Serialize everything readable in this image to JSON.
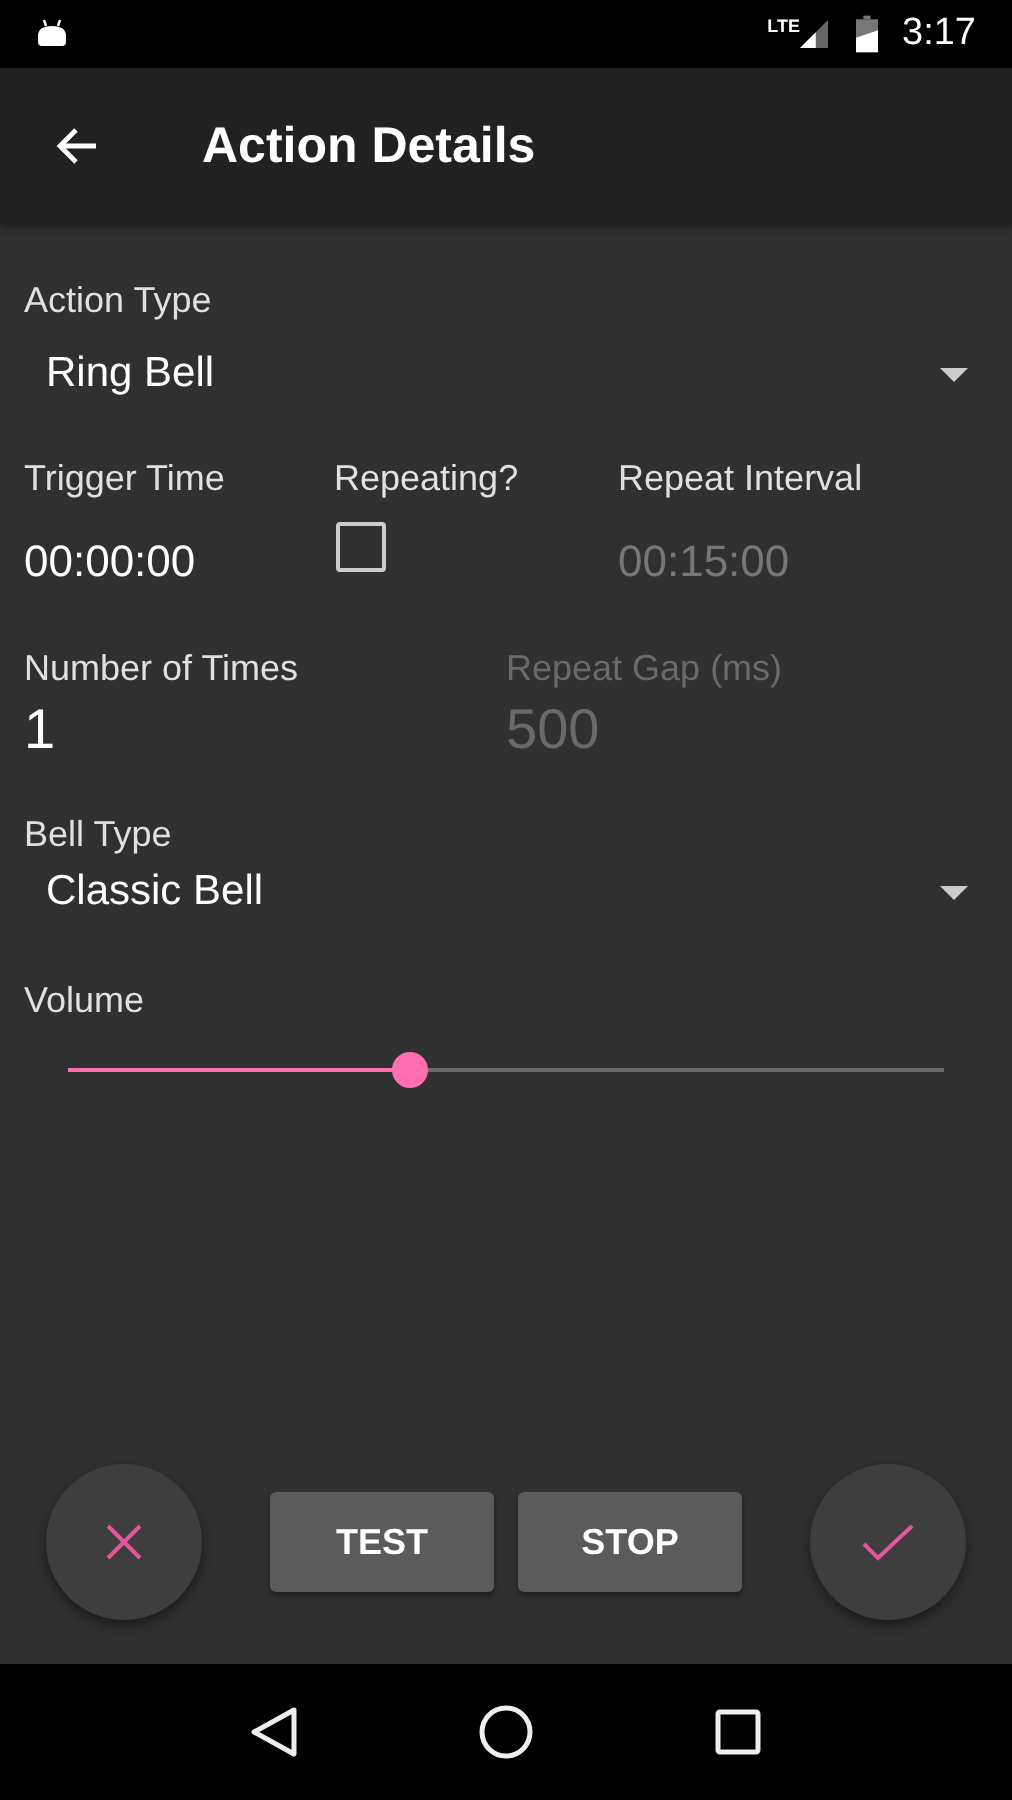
{
  "status_bar": {
    "network": "LTE",
    "time": "3:17"
  },
  "toolbar": {
    "title": "Action Details"
  },
  "action_type": {
    "label": "Action Type",
    "value": "Ring Bell"
  },
  "timing": [
    {
      "kind": "text",
      "label": "Trigger Time",
      "value": "00:00:00",
      "disabled": false
    },
    {
      "kind": "checkbox",
      "label": "Repeating?",
      "checked": false
    },
    {
      "kind": "text",
      "label": "Repeat Interval",
      "value": "00:15:00",
      "disabled": true
    }
  ],
  "count": [
    {
      "label": "Number of Times",
      "value": "1",
      "disabled": false
    },
    {
      "label": "Repeat Gap (ms)",
      "value": "500",
      "disabled": true
    }
  ],
  "bell_type": {
    "label": "Bell Type",
    "value": "Classic Bell"
  },
  "volume": {
    "label": "Volume",
    "level": 0.39
  },
  "buttons": [
    "TEST",
    "STOP"
  ]
}
